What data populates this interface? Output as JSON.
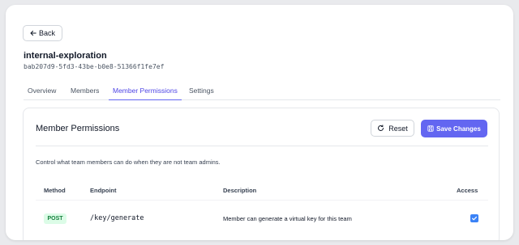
{
  "back_button": {
    "label": "Back",
    "icon": "arrow-left-icon"
  },
  "team": {
    "name": "internal-exploration",
    "id": "bab207d9-5fd3-43be-b0e8-51366f1fe7ef"
  },
  "tabs": [
    {
      "label": "Overview",
      "active": false
    },
    {
      "label": "Members",
      "active": false
    },
    {
      "label": "Member Permissions",
      "active": true
    },
    {
      "label": "Settings",
      "active": false
    }
  ],
  "permissions_card": {
    "title": "Member Permissions",
    "reset_label": "Reset",
    "reset_icon": "refresh-icon",
    "save_label": "Save Changes",
    "save_icon": "save-icon",
    "description": "Control what team members can do when they are not team admins.",
    "columns": [
      "Method",
      "Endpoint",
      "Description",
      "Access"
    ],
    "rows": [
      {
        "method": "POST",
        "endpoint": "/key/generate",
        "description": "Member can generate a virtual key for this team",
        "access": true
      }
    ]
  },
  "colors": {
    "accent": "#6366f1",
    "active_tab": "#4f46e5",
    "method_post_bg": "#dcfce7",
    "method_post_fg": "#15803d",
    "checkbox": "#3b82f6"
  }
}
